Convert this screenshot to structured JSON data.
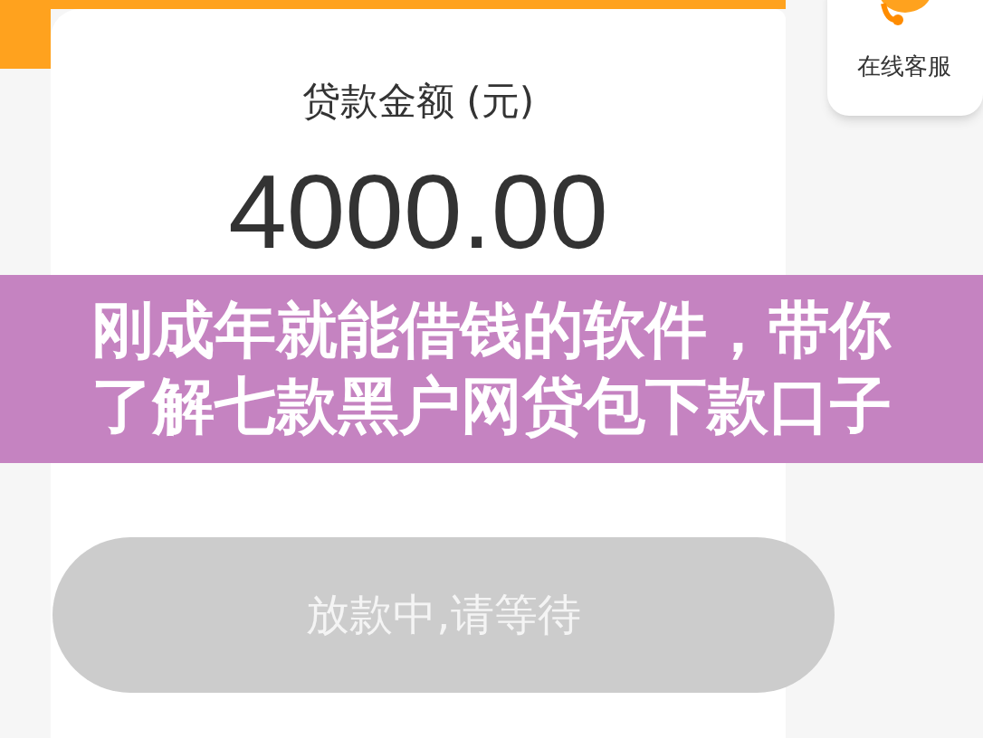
{
  "customer_service": {
    "label": "在线客服"
  },
  "loan": {
    "label": "贷款金额 (元)",
    "amount": "4000.00"
  },
  "banner": {
    "lines": [
      "刚成年就能借钱的软件，带你",
      "了解七款黑户网贷包下款口子"
    ]
  },
  "status_button": {
    "label": "放款中,请等待",
    "disabled": true
  }
}
